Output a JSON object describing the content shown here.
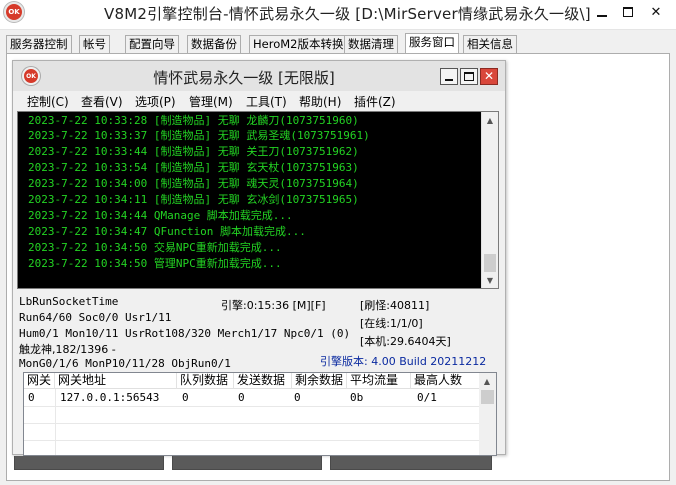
{
  "window": {
    "title": "V8M2引擎控制台-情怀武易永久一级 [D:\\MirServer情缘武易永久一级\\]",
    "icon": "app-logo-icon",
    "icon_text": "OK"
  },
  "tabs": [
    {
      "label": "服务器控制"
    },
    {
      "label": "帐号"
    },
    {
      "label": "配置向导"
    },
    {
      "label": "数据备份"
    },
    {
      "label": "HeroM2版本转换"
    },
    {
      "label": "数据清理"
    },
    {
      "label": "服务窗口",
      "active": true
    },
    {
      "label": "相关信息"
    }
  ],
  "inner_window": {
    "title": "情怀武易永久一级 [无限版]",
    "icon_text": "OK",
    "close_glyph": "✕"
  },
  "menu": [
    {
      "label": "控制(C)"
    },
    {
      "label": "查看(V)"
    },
    {
      "label": "选项(P)"
    },
    {
      "label": "管理(M)"
    },
    {
      "label": "工具(T)"
    },
    {
      "label": "帮助(H)"
    },
    {
      "label": "插件(Z)"
    }
  ],
  "console_lines": [
    "2023-7-22 10:33:28 [制造物品] 无聊 龙麟刀(1073751960)",
    "2023-7-22 10:33:37 [制造物品] 无聊 武易圣魂(1073751961)",
    "2023-7-22 10:33:44 [制造物品] 无聊 关王刀(1073751962)",
    "2023-7-22 10:33:54 [制造物品] 无聊 玄天杖(1073751963)",
    "2023-7-22 10:34:00 [制造物品] 无聊 魂天灵(1073751964)",
    "2023-7-22 10:34:11 [制造物品] 无聊 玄冰剑(1073751965)",
    "2023-7-22 10:34:44 QManage 脚本加载完成...",
    "2023-7-22 10:34:47 QFunction 脚本加载完成...",
    "2023-7-22 10:34:50 交易NPC重新加载完成...",
    "2023-7-22 10:34:50 管理NPC重新加载完成..."
  ],
  "console_color": "#23d323",
  "status": {
    "socket": "LbRunSocketTime",
    "engine_time": "引擎:0:15:36 [M][F]",
    "monster_refresh": "[刷怪:40811]",
    "run": "Run64/60 Soc0/0 Usr1/11",
    "online": "[在线:1/1/0]",
    "hum": "Hum0/1 Mon10/11 UsrRot108/320 Merch1/17 Npc0/1 (0)",
    "local": "[本机:29.6404天]",
    "dragon": "触龙神,182/1396 -",
    "mon": "MonG0/1/6 MonP10/11/28 ObjRun0/1",
    "engine_version": "引擎版本: 4.00 Build 20211212"
  },
  "gateway_table": {
    "headers": [
      "网关",
      "网关地址",
      "队列数据",
      "发送数据",
      "剩余数据",
      "平均流量",
      "最高人数"
    ],
    "rows": [
      [
        "0",
        "127.0.0.1:56543",
        "0",
        "0",
        "0",
        "0b",
        "0/1"
      ]
    ]
  }
}
